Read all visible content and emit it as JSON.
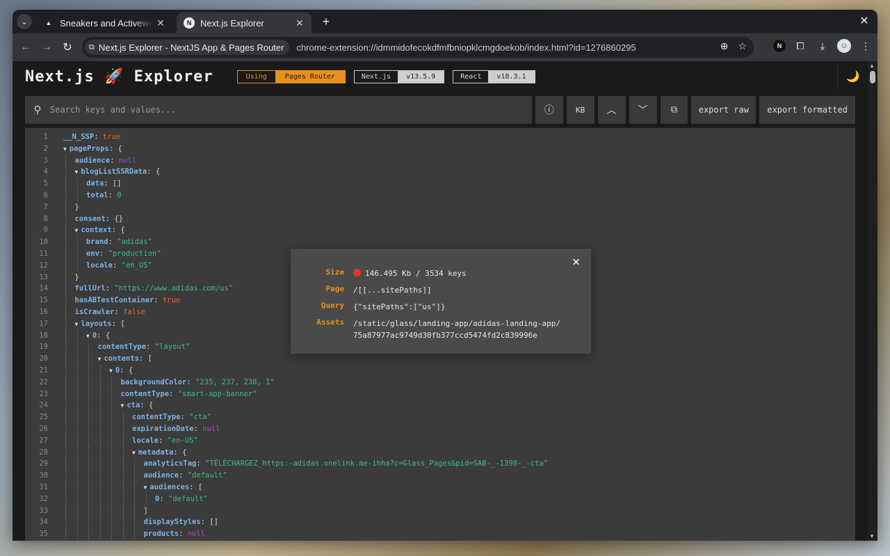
{
  "browser": {
    "tabs": [
      {
        "title": "Sneakers and Activewear",
        "favicon": "adidas-logo-icon",
        "active": false
      },
      {
        "title": "Next.js Explorer",
        "favicon": "nextjs-logo-icon",
        "active": true
      }
    ],
    "omnibox_chip": "Next.js Explorer - NextJS App & Pages Router",
    "url": "chrome-extension://idmmidofecokdfmfbniopklcmgdoekob/index.html?id=1276860295"
  },
  "header": {
    "brand": "Next.js 🚀 Explorer",
    "badges": [
      {
        "key": "Using",
        "value": "Pages Router"
      },
      {
        "key": "Next.js",
        "value": "v13.5.9"
      },
      {
        "key": "React",
        "value": "v18.3.1"
      }
    ]
  },
  "search": {
    "placeholder": "Search keys and values..."
  },
  "buttons": {
    "kb": "KB",
    "export_raw": "export raw",
    "export_formatted": "export formatted"
  },
  "modal": {
    "size_label": "Size",
    "size_value": "146.495 Kb / 3534 keys",
    "page_label": "Page",
    "page_value": "/[[...sitePaths]]",
    "query_label": "Query",
    "query_value": "{\"sitePaths\":[\"us\"]}",
    "assets_label": "Assets",
    "assets_value": "/static/glass/landing-app/adidas-landing-app/75a87977ac9749d30fb377ccd5474fd2c839996e"
  },
  "code_lines": [
    {
      "n": "1",
      "d": 0,
      "k": "__N_SSP",
      "v": "true",
      "t": "bool"
    },
    {
      "n": "2",
      "d": 0,
      "k": "pageProps",
      "v": "{",
      "t": "open"
    },
    {
      "n": "3",
      "d": 1,
      "k": "audience",
      "v": "null",
      "t": "nul"
    },
    {
      "n": "4",
      "d": 1,
      "k": "blogListSSRData",
      "v": "{",
      "t": "open"
    },
    {
      "n": "5",
      "d": 2,
      "k": "data",
      "v": "[]",
      "t": "punc"
    },
    {
      "n": "6",
      "d": 2,
      "k": "total",
      "v": "0",
      "t": "num"
    },
    {
      "n": "7",
      "d": 1,
      "k": "",
      "v": "}",
      "t": "close"
    },
    {
      "n": "8",
      "d": 1,
      "k": "consent",
      "v": "{}",
      "t": "punc"
    },
    {
      "n": "9",
      "d": 1,
      "k": "context",
      "v": "{",
      "t": "open"
    },
    {
      "n": "10",
      "d": 2,
      "k": "brand",
      "v": "\"adidas\"",
      "t": "str"
    },
    {
      "n": "11",
      "d": 2,
      "k": "env",
      "v": "\"production\"",
      "t": "str"
    },
    {
      "n": "12",
      "d": 2,
      "k": "locale",
      "v": "\"en_US\"",
      "t": "str"
    },
    {
      "n": "13",
      "d": 1,
      "k": "",
      "v": "}",
      "t": "close"
    },
    {
      "n": "14",
      "d": 1,
      "k": "fullUrl",
      "v": "\"https://www.adidas.com/us\"",
      "t": "str"
    },
    {
      "n": "15",
      "d": 1,
      "k": "hasABTestContainer",
      "v": "true",
      "t": "bool"
    },
    {
      "n": "16",
      "d": 1,
      "k": "isCrawler",
      "v": "false",
      "t": "bool"
    },
    {
      "n": "17",
      "d": 1,
      "k": "layouts",
      "v": "[",
      "t": "open"
    },
    {
      "n": "18",
      "d": 2,
      "k": "0",
      "v": "{",
      "t": "open"
    },
    {
      "n": "19",
      "d": 3,
      "k": "contentType",
      "v": "\"layout\"",
      "t": "str"
    },
    {
      "n": "20",
      "d": 3,
      "k": "contents",
      "v": "[",
      "t": "open"
    },
    {
      "n": "21",
      "d": 4,
      "k": "0",
      "v": "{",
      "t": "open"
    },
    {
      "n": "22",
      "d": 5,
      "k": "backgroundColor",
      "v": "\"235, 237, 238, 1\"",
      "t": "str"
    },
    {
      "n": "23",
      "d": 5,
      "k": "contentType",
      "v": "\"smart-app-banner\"",
      "t": "str"
    },
    {
      "n": "24",
      "d": 5,
      "k": "cta",
      "v": "{",
      "t": "open"
    },
    {
      "n": "25",
      "d": 6,
      "k": "contentType",
      "v": "\"cta\"",
      "t": "str"
    },
    {
      "n": "26",
      "d": 6,
      "k": "expirationDate",
      "v": "null",
      "t": "nul"
    },
    {
      "n": "27",
      "d": 6,
      "k": "locale",
      "v": "\"en-US\"",
      "t": "str"
    },
    {
      "n": "28",
      "d": 6,
      "k": "metadata",
      "v": "{",
      "t": "open"
    },
    {
      "n": "29",
      "d": 7,
      "k": "analyticsTag",
      "v": "\"TÉLÉCHARGEZ_https:-adidas.onelink.me-ihha?c=Glass_Pages&pid=SAB-_-1399-_-cta\"",
      "t": "str"
    },
    {
      "n": "30",
      "d": 7,
      "k": "audience",
      "v": "\"default\"",
      "t": "str"
    },
    {
      "n": "31",
      "d": 7,
      "k": "audiences",
      "v": "[",
      "t": "open"
    },
    {
      "n": "32",
      "d": 8,
      "k": "0",
      "v": "\"default\"",
      "t": "str"
    },
    {
      "n": "33",
      "d": 7,
      "k": "",
      "v": "]",
      "t": "close"
    },
    {
      "n": "34",
      "d": 7,
      "k": "displayStyles",
      "v": "[]",
      "t": "punc"
    },
    {
      "n": "35",
      "d": 7,
      "k": "products",
      "v": "null",
      "t": "nul"
    }
  ]
}
